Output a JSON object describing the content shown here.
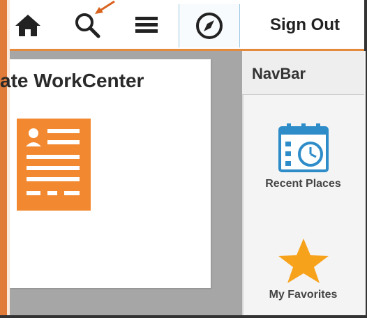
{
  "toolbar": {
    "home": {
      "icon": "home-icon"
    },
    "search": {
      "icon": "search-icon"
    },
    "menu": {
      "icon": "hamburger-menu-icon"
    },
    "navbar": {
      "icon": "compass-icon"
    },
    "sign_out_label": "Sign Out"
  },
  "main": {
    "card_title": "ate WorkCenter",
    "card_icon": "document-person-icon"
  },
  "navbar_panel": {
    "title": "NavBar",
    "tiles": [
      {
        "label": "Recent Places",
        "icon": "calendar-clock-icon"
      },
      {
        "label": "My Favorites",
        "icon": "star-icon"
      }
    ]
  },
  "colors": {
    "accent_orange": "#E58A3C",
    "frame_orange": "#E07B39",
    "tile_blue": "#2E8CC8",
    "star_orange": "#F7A21B",
    "content_gray": "#A6A6A6"
  }
}
